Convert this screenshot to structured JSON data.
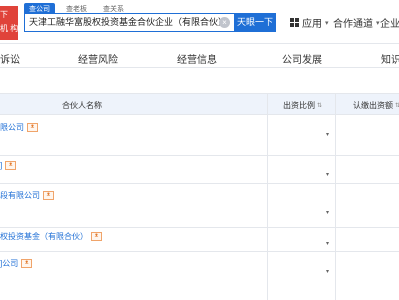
{
  "header": {
    "badge_line1": "下",
    "badge_line2": "机 构",
    "search_tabs": [
      "查公司",
      "查老板",
      "查关系"
    ],
    "search_value": "天津工融华富股权投资基金合伙企业（有限合伙）",
    "clear_glyph": "×",
    "search_button": "天眼一下",
    "nav": [
      {
        "label": "应用"
      },
      {
        "label": "合作通道"
      },
      {
        "label": "企业"
      }
    ]
  },
  "tabs": [
    "诉讼",
    "经营风险",
    "经营信息",
    "公司发展",
    "知识"
  ],
  "table": {
    "columns": [
      "合伙人名称",
      "出资比例",
      "认缴出资额"
    ],
    "rows": [
      {
        "name": "限公司"
      },
      {
        "name": "]"
      },
      {
        "name": "段有限公司"
      },
      {
        "name": "权投资基金（有限合伙）"
      },
      {
        "name": "]公司"
      }
    ]
  },
  "colors": {
    "accent": "#1f6fd6",
    "badge": "#e0433a",
    "tag": "#e27a2e"
  },
  "icons": {
    "person_tag": "person-tag-icon",
    "clear": "clear-icon",
    "grid": "grid-icon"
  }
}
